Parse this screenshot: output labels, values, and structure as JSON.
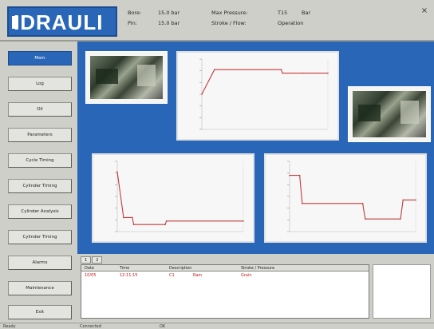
{
  "app": {
    "logo": "IDRAULI"
  },
  "header": {
    "status": [
      {
        "label": "Bore:",
        "value": "15.0 bar"
      },
      {
        "label": "Pin:",
        "value": "15.0 bar"
      },
      {
        "label": "Max Pressure:",
        "value": "T15",
        "extra": "Bar"
      },
      {
        "label": "Stroke / Flow:",
        "value": "Operation"
      }
    ],
    "close": "×"
  },
  "nav": {
    "items": [
      {
        "label": "Main",
        "active": true
      },
      {
        "label": "Log",
        "active": false
      },
      {
        "label": "Oil",
        "active": false
      },
      {
        "label": "Parameters",
        "active": false
      },
      {
        "label": "Cycle Timing",
        "active": false
      },
      {
        "label": "Cylinder Timing",
        "active": false
      },
      {
        "label": "Cylinder Analysis",
        "active": false
      },
      {
        "label": "Cylinder Timing",
        "active": false
      },
      {
        "label": "Alarms",
        "active": false
      },
      {
        "label": "Maintenance",
        "active": false
      },
      {
        "label": "Exit",
        "active": false
      }
    ]
  },
  "table": {
    "tabs": [
      "1",
      "2"
    ],
    "headers": [
      "Date",
      "Time",
      "Description",
      "Stroke / Pressure"
    ],
    "row": [
      "10/05",
      "12:11:15",
      "C1",
      "Ram",
      "Grain"
    ]
  },
  "statusbar": [
    "Ready",
    "Connected",
    "OK"
  ],
  "chart_data": [
    {
      "type": "line",
      "x": [
        0,
        1,
        6.3,
        6.4,
        8,
        10
      ],
      "values": [
        50,
        85,
        85,
        80,
        80,
        80
      ],
      "ylim": [
        0,
        100
      ],
      "color": "#c43a3a"
    },
    {
      "type": "line",
      "x": [
        0,
        0.5,
        1.2,
        1.3,
        3.8,
        3.9,
        10
      ],
      "values": [
        85,
        20,
        20,
        10,
        10,
        15,
        15
      ],
      "ylim": [
        0,
        100
      ],
      "color": "#c43a3a"
    },
    {
      "type": "line",
      "x": [
        0,
        0.8,
        1.0,
        5.8,
        6.0,
        8.8,
        9.0,
        10
      ],
      "values": [
        80,
        80,
        40,
        40,
        18,
        18,
        45,
        45
      ],
      "ylim": [
        0,
        100
      ],
      "color": "#c43a3a"
    }
  ]
}
